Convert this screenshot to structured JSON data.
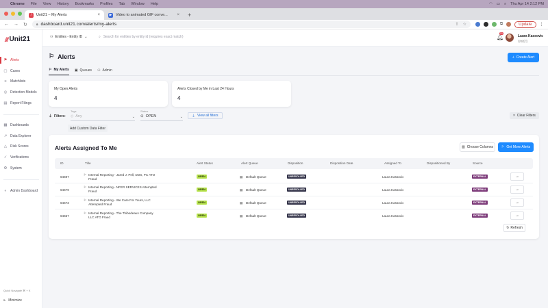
{
  "os_menu": {
    "apple": "",
    "items": [
      "Chrome",
      "File",
      "View",
      "History",
      "Bookmarks",
      "Profiles",
      "Tab",
      "Window",
      "Help"
    ],
    "clock": "Thu Apr 14  2:12 PM"
  },
  "browser": {
    "tabs": [
      {
        "title": "Unit21 – My Alerts",
        "active": true
      },
      {
        "title": "Video to animated GIF conve...",
        "active": false
      }
    ],
    "url": "dashboard.unit21.com/alerts/my-alerts",
    "update_label": "Update"
  },
  "app": {
    "logo_mark": "///",
    "logo_text": "Unit21",
    "entity_selector": "Entities - Entity ID",
    "search_placeholder": "Search for entities by entity id (requires exact match)",
    "notif_count": "21",
    "user_name": "Laura Kassovic",
    "user_org": "Unit21"
  },
  "sidebar": {
    "items": [
      {
        "label": "Alerts",
        "icon": "flag-icon"
      },
      {
        "label": "Cases",
        "icon": "cases-icon"
      },
      {
        "label": "Matchlists",
        "icon": "list-icon"
      },
      {
        "label": "Detection Models",
        "icon": "model-icon"
      },
      {
        "label": "Report Filings",
        "icon": "report-icon"
      },
      {
        "label": "Dashboards",
        "icon": "dashboard-icon"
      },
      {
        "label": "Data Explorer",
        "icon": "explorer-icon"
      },
      {
        "label": "Risk Scores",
        "icon": "risk-icon"
      },
      {
        "label": "Verifications",
        "icon": "verify-icon"
      },
      {
        "label": "System",
        "icon": "system-icon"
      },
      {
        "label": "Admin Dashboard",
        "icon": "admin-icon"
      }
    ],
    "quick_navigate": "Quick Navigate  ⌘ + K",
    "minimize": "Minimize"
  },
  "page": {
    "title": "Alerts",
    "create_button": "Create Alert",
    "tabs": [
      "My Alerts",
      "Queues",
      "Admin"
    ]
  },
  "stats": [
    {
      "label": "My Open Alerts",
      "value": "4"
    },
    {
      "label": "Alerts Closed by Me in Last 24 Hours",
      "value": "4"
    }
  ],
  "filters": {
    "label": "Filters:",
    "tag_caption": "Tags",
    "tag_value": "Any",
    "status_caption": "Status",
    "status_value": "OPEN",
    "view_all": "View all filters",
    "clear": "Clear Filters",
    "add_custom": "Add Custom Data Filter"
  },
  "table": {
    "title": "Alerts Assigned To Me",
    "choose_columns": "Choose Columns",
    "get_more": "Get More Alerts",
    "refresh": "Refresh",
    "columns": [
      "ID",
      "Title",
      "Alert Status",
      "Alert Queue",
      "Disposition",
      "Disposition Date",
      "Assigned To",
      "Dispositioned By",
      "Source"
    ],
    "rows": [
      {
        "id": "64697",
        "title": "Internal Reporting - Jared J. Pell, DDS, PC ATO Fraud",
        "status": "OPEN",
        "queue": "Default Queue",
        "disposition": "UNRESOLVED",
        "disposition_date": "",
        "assigned_to": "Laura Kassovic",
        "dispositioned_by": "",
        "source": "EXTERNAL"
      },
      {
        "id": "64679",
        "title": "Internal Reporting - NFER SERVICES Attempted Fraud",
        "status": "OPEN",
        "queue": "Default Queue",
        "disposition": "UNRESOLVED",
        "disposition_date": "",
        "assigned_to": "Laura Kassovic",
        "dispositioned_by": "",
        "source": "EXTERNAL"
      },
      {
        "id": "64673",
        "title": "Internal Reporting - We Care For Yours, LLC Attempted Fraud",
        "status": "OPEN",
        "queue": "Default Queue",
        "disposition": "UNRESOLVED",
        "disposition_date": "",
        "assigned_to": "Laura Kassovic",
        "dispositioned_by": "",
        "source": "EXTERNAL"
      },
      {
        "id": "64657",
        "title": "Internal Reporting - The Thibodeaux Company LLC ATO Fraud",
        "status": "OPEN",
        "queue": "Default Queue",
        "disposition": "UNRESOLVED",
        "disposition_date": "",
        "assigned_to": "Laura Kassovic",
        "dispositioned_by": "",
        "source": "EXTERNAL"
      }
    ]
  },
  "colors": {
    "brand_red": "#d9363f",
    "primary_blue": "#1e8bff",
    "status_open": "#b6e24c",
    "disposition_unresolved": "#34344a",
    "source_external": "#7c3a79"
  }
}
